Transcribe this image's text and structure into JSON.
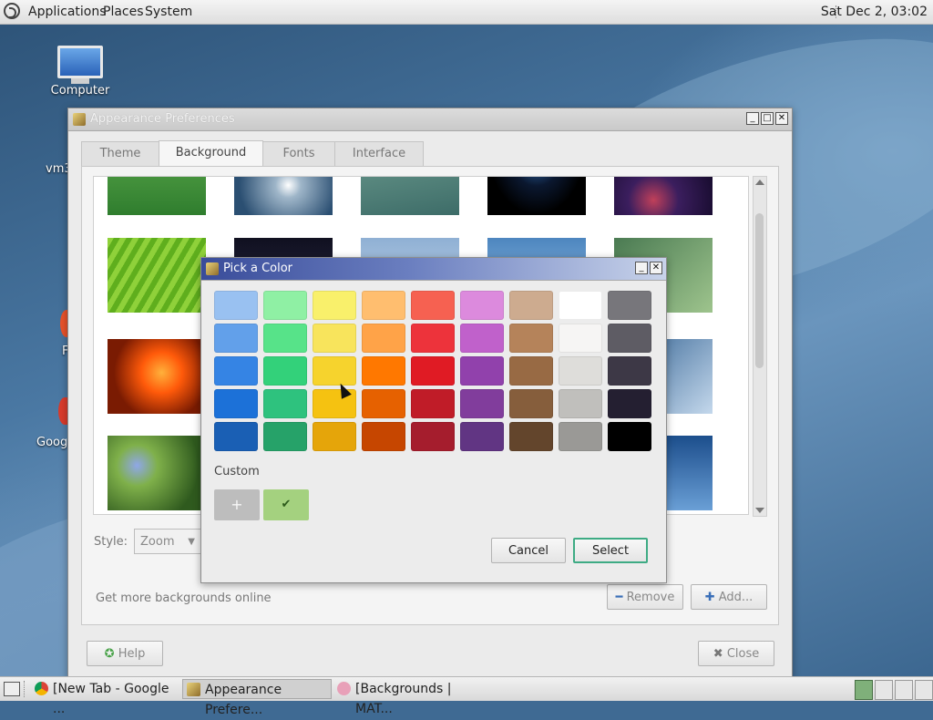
{
  "top_panel": {
    "menus": [
      "Applications",
      "Places",
      "System"
    ],
    "clock": "Sat Dec 2, 03:02"
  },
  "desktop": {
    "icons": [
      {
        "label": "Computer"
      },
      {
        "label": "vm3"
      },
      {
        "label": "F"
      },
      {
        "label": "Goog"
      }
    ]
  },
  "appearance_window": {
    "title": "Appearance Preferences",
    "tabs": [
      "Theme",
      "Background",
      "Fonts",
      "Interface"
    ],
    "active_tab": "Background",
    "style_label": "Style:",
    "style_value": "Zoom",
    "more_backgrounds": "Get more backgrounds online",
    "remove_label": "Remove",
    "add_label": "Add...",
    "help_label": "Help",
    "close_label": "Close"
  },
  "color_dialog": {
    "title": "Pick a Color",
    "palette": [
      [
        "#99c1f1",
        "#8ff0a4",
        "#f9f06b",
        "#ffbe6f",
        "#f66151",
        "#dc8add",
        "#cdab8f",
        "#ffffff",
        "#77767b"
      ],
      [
        "#62a0ea",
        "#57e389",
        "#f8e45c",
        "#ffa348",
        "#ed333b",
        "#c061cb",
        "#b5835a",
        "#f6f5f4",
        "#5e5c64"
      ],
      [
        "#3584e4",
        "#33d17a",
        "#f6d32d",
        "#ff7800",
        "#e01b24",
        "#9141ac",
        "#986a44",
        "#deddda",
        "#3d3846"
      ],
      [
        "#1c71d8",
        "#2ec27e",
        "#f5c211",
        "#e66100",
        "#c01c28",
        "#813d9c",
        "#865e3c",
        "#c0bfbc",
        "#241f31"
      ],
      [
        "#1a5fb4",
        "#26a269",
        "#e5a50a",
        "#c64600",
        "#a51d2d",
        "#613583",
        "#63452c",
        "#9a9996",
        "#000000"
      ]
    ],
    "custom_label": "Custom",
    "add_custom_glyph": "+",
    "selected_custom_color": "#a4d17f",
    "check_glyph": "✔",
    "cancel_label": "Cancel",
    "select_label": "Select"
  },
  "taskbar": {
    "items": [
      {
        "label": "[New Tab - Google ..."
      },
      {
        "label": "Appearance Prefere..."
      },
      {
        "label": "[Backgrounds | MAT..."
      }
    ]
  }
}
